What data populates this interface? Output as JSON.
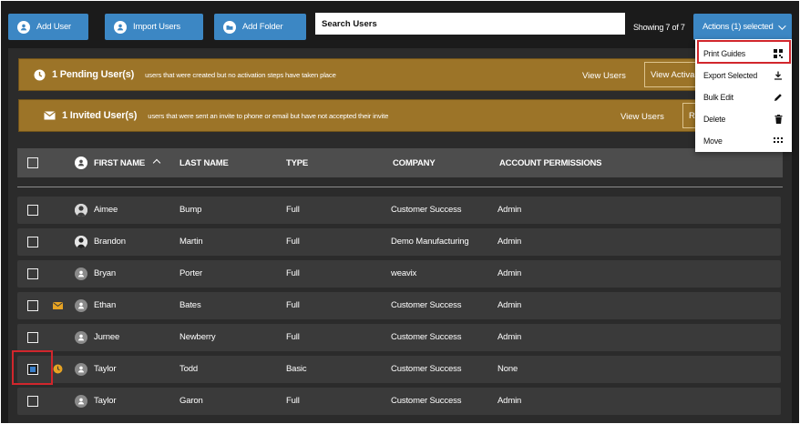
{
  "toolbar": {
    "add_user": "Add User",
    "import_users": "Import Users",
    "add_folder": "Add Folder",
    "search_placeholder": "Search Users",
    "showing": "Showing 7 of 7",
    "actions": "Actions (1) selected"
  },
  "banners": {
    "pending": {
      "title": "1 Pending User(s)",
      "description": "users that were created but no activation steps have taken place",
      "view_label": "View Users",
      "action_label": "View Activa"
    },
    "invited": {
      "title": "1 Invited User(s)",
      "description": "users that were sent an invite to phone or email but have not accepted their invite",
      "view_label": "View Users",
      "action_label": "R"
    }
  },
  "table": {
    "columns": [
      "FIRST NAME",
      "LAST NAME",
      "TYPE",
      "COMPANY",
      "ACCOUNT PERMISSIONS"
    ],
    "rows": [
      {
        "first": "Aimee",
        "last": "Bump",
        "type": "Full",
        "company": "Customer Success",
        "permissions": "Admin",
        "checked": false,
        "avatar": "photo"
      },
      {
        "first": "Brandon",
        "last": "Martin",
        "type": "Full",
        "company": "Demo Manufacturing",
        "permissions": "Admin",
        "checked": false,
        "avatar": "photo"
      },
      {
        "first": "Bryan",
        "last": "Porter",
        "type": "Full",
        "company": "weavix",
        "permissions": "Admin",
        "checked": false,
        "avatar": "default"
      },
      {
        "first": "Ethan",
        "last": "Bates",
        "type": "Full",
        "company": "Customer Success",
        "permissions": "Admin",
        "checked": false,
        "avatar": "default",
        "status_icon": "envelope-icon"
      },
      {
        "first": "Jurnee",
        "last": "Newberry",
        "type": "Full",
        "company": "Customer Success",
        "permissions": "Admin",
        "checked": false,
        "avatar": "default"
      },
      {
        "first": "Taylor",
        "last": "Todd",
        "type": "Basic",
        "company": "Customer Success",
        "permissions": "None",
        "checked": true,
        "avatar": "default",
        "status_icon": "clock-icon"
      },
      {
        "first": "Taylor",
        "last": "Garon",
        "type": "Full",
        "company": "Customer Success",
        "permissions": "Admin",
        "checked": false,
        "avatar": "default"
      }
    ]
  },
  "menu": {
    "items": [
      {
        "label": "Print Guides",
        "icon": "qr-code-icon"
      },
      {
        "label": "Export Selected",
        "icon": "download-icon"
      },
      {
        "label": "Bulk Edit",
        "icon": "pencil-icon"
      },
      {
        "label": "Delete",
        "icon": "trash-icon"
      },
      {
        "label": "Move",
        "icon": "grid-icon"
      }
    ]
  },
  "colors": {
    "accent_blue": "#3c87c4",
    "banner_gold": "#9c7428",
    "highlight_red": "#d1262c",
    "status_orange": "#e7a323"
  }
}
